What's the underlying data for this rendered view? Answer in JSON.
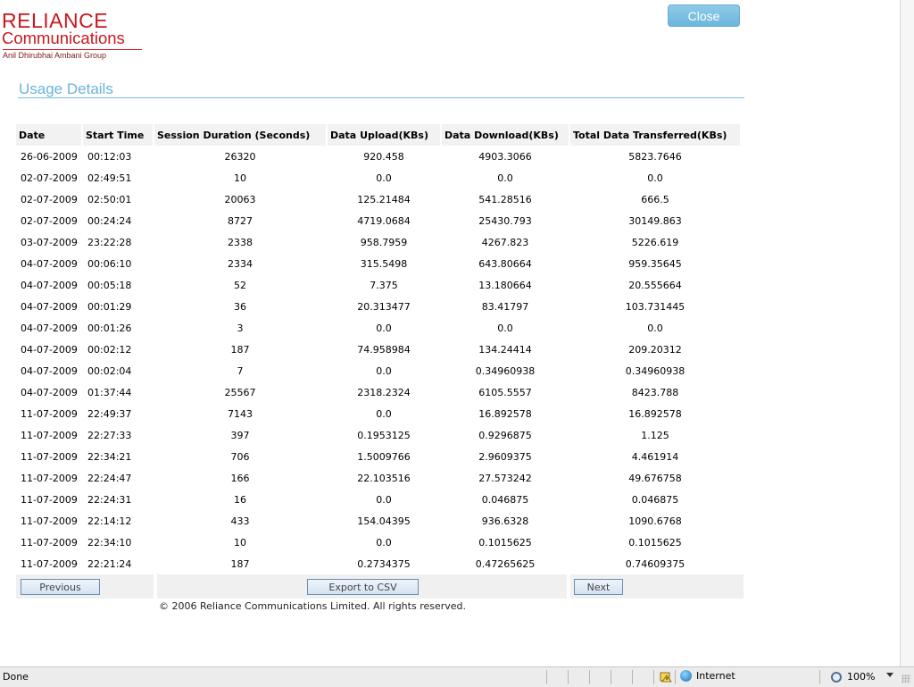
{
  "logo": {
    "brand": "RELIANCE",
    "subtitle": "Communications",
    "group": "Anil Dhirubhai Ambani Group"
  },
  "close_label": "Close",
  "title": "Usage Details",
  "table": {
    "headers": [
      "Date",
      "Start Time",
      "Session Duration (Seconds)",
      "Data Upload(KBs)",
      "Data Download(KBs)",
      "Total Data Transferred(KBs)"
    ],
    "rows": [
      [
        "26-06-2009",
        "00:12:03",
        "26320",
        "920.458",
        "4903.3066",
        "5823.7646"
      ],
      [
        "02-07-2009",
        "02:49:51",
        "10",
        "0.0",
        "0.0",
        "0.0"
      ],
      [
        "02-07-2009",
        "02:50:01",
        "20063",
        "125.21484",
        "541.28516",
        "666.5"
      ],
      [
        "02-07-2009",
        "00:24:24",
        "8727",
        "4719.0684",
        "25430.793",
        "30149.863"
      ],
      [
        "03-07-2009",
        "23:22:28",
        "2338",
        "958.7959",
        "4267.823",
        "5226.619"
      ],
      [
        "04-07-2009",
        "00:06:10",
        "2334",
        "315.5498",
        "643.80664",
        "959.35645"
      ],
      [
        "04-07-2009",
        "00:05:18",
        "52",
        "7.375",
        "13.180664",
        "20.555664"
      ],
      [
        "04-07-2009",
        "00:01:29",
        "36",
        "20.313477",
        "83.41797",
        "103.731445"
      ],
      [
        "04-07-2009",
        "00:01:26",
        "3",
        "0.0",
        "0.0",
        "0.0"
      ],
      [
        "04-07-2009",
        "00:02:12",
        "187",
        "74.958984",
        "134.24414",
        "209.20312"
      ],
      [
        "04-07-2009",
        "00:02:04",
        "7",
        "0.0",
        "0.34960938",
        "0.34960938"
      ],
      [
        "04-07-2009",
        "01:37:44",
        "25567",
        "2318.2324",
        "6105.5557",
        "8423.788"
      ],
      [
        "11-07-2009",
        "22:49:37",
        "7143",
        "0.0",
        "16.892578",
        "16.892578"
      ],
      [
        "11-07-2009",
        "22:27:33",
        "397",
        "0.1953125",
        "0.9296875",
        "1.125"
      ],
      [
        "11-07-2009",
        "22:34:21",
        "706",
        "1.5009766",
        "2.9609375",
        "4.461914"
      ],
      [
        "11-07-2009",
        "22:24:47",
        "166",
        "22.103516",
        "27.573242",
        "49.676758"
      ],
      [
        "11-07-2009",
        "22:24:31",
        "16",
        "0.0",
        "0.046875",
        "0.046875"
      ],
      [
        "11-07-2009",
        "22:14:12",
        "433",
        "154.04395",
        "936.6328",
        "1090.6768"
      ],
      [
        "11-07-2009",
        "22:34:10",
        "10",
        "0.0",
        "0.1015625",
        "0.1015625"
      ],
      [
        "11-07-2009",
        "22:21:24",
        "187",
        "0.2734375",
        "0.47265625",
        "0.74609375"
      ]
    ]
  },
  "pager": {
    "previous_label": "Previous",
    "export_label": "Export to CSV",
    "next_label": "Next"
  },
  "copyright": "© 2006 Reliance Communications Limited. All rights reserved.",
  "statusbar": {
    "status": "Done",
    "zone": "Internet",
    "zoom": "100%"
  },
  "colors": {
    "brand_red": "#c8181e",
    "title_blue": "#6ab3d9",
    "close_button": "#7cc0e2"
  }
}
